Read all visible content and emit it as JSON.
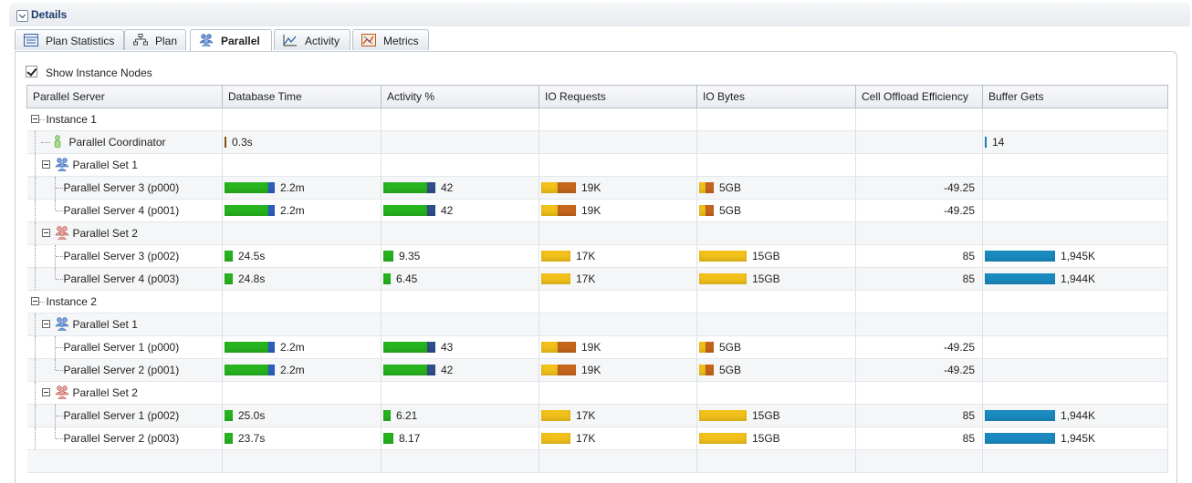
{
  "details": {
    "title": "Details"
  },
  "tabs": [
    {
      "label": "Plan Statistics",
      "icon": "table-icon",
      "active": false
    },
    {
      "label": "Plan",
      "icon": "tree-icon",
      "active": false
    },
    {
      "label": "Parallel",
      "icon": "people-icon",
      "active": true
    },
    {
      "label": "Activity",
      "icon": "line-chart-icon",
      "active": false
    },
    {
      "label": "Metrics",
      "icon": "metrics-icon",
      "active": false
    }
  ],
  "show_instance_nodes": {
    "label": "Show Instance Nodes",
    "checked": true
  },
  "columns": [
    "Parallel Server",
    "Database Time",
    "Activity %",
    "IO Requests",
    "IO Bytes",
    "Cell Offload Efficiency",
    "Buffer Gets"
  ],
  "colors": {
    "db_green": "#27b41e",
    "db_blue": "#2e5fc4",
    "act_navy": "#2f4f8a",
    "io_yellow": "#f2c21b",
    "io_orange": "#c8661b",
    "buf_cyan": "#1a8ac0"
  },
  "rows": [
    {
      "label": "Instance 1",
      "kind": "instance"
    },
    {
      "label": "Parallel Coordinator",
      "kind": "coordinator",
      "db_time": "0.3s",
      "buffer_gets": "14"
    },
    {
      "label": "Parallel Set 1",
      "kind": "set",
      "set_color": "blue"
    },
    {
      "label": "Parallel Server 3 (p000)",
      "kind": "server",
      "db_time": "2.2m",
      "activity": "42",
      "io_requests": "19K",
      "io_bytes": "5GB",
      "offload": "-49.25",
      "buffer_gets": ""
    },
    {
      "label": "Parallel Server 4 (p001)",
      "kind": "server",
      "db_time": "2.2m",
      "activity": "42",
      "io_requests": "19K",
      "io_bytes": "5GB",
      "offload": "-49.25",
      "buffer_gets": ""
    },
    {
      "label": "Parallel Set 2",
      "kind": "set",
      "set_color": "red"
    },
    {
      "label": "Parallel Server 3 (p002)",
      "kind": "server",
      "db_time": "24.5s",
      "activity": "9.35",
      "io_requests": "17K",
      "io_bytes": "15GB",
      "offload": "85",
      "buffer_gets": "1,945K"
    },
    {
      "label": "Parallel Server 4 (p003)",
      "kind": "server",
      "db_time": "24.8s",
      "activity": "6.45",
      "io_requests": "17K",
      "io_bytes": "15GB",
      "offload": "85",
      "buffer_gets": "1,944K"
    },
    {
      "label": "Instance 2",
      "kind": "instance"
    },
    {
      "label": "Parallel Set 1",
      "kind": "set",
      "set_color": "blue"
    },
    {
      "label": "Parallel Server 1 (p000)",
      "kind": "server",
      "db_time": "2.2m",
      "activity": "43",
      "io_requests": "19K",
      "io_bytes": "5GB",
      "offload": "-49.25",
      "buffer_gets": ""
    },
    {
      "label": "Parallel Server 2 (p001)",
      "kind": "server",
      "db_time": "2.2m",
      "activity": "42",
      "io_requests": "19K",
      "io_bytes": "5GB",
      "offload": "-49.25",
      "buffer_gets": ""
    },
    {
      "label": "Parallel Set 2",
      "kind": "set",
      "set_color": "red"
    },
    {
      "label": "Parallel Server 1 (p002)",
      "kind": "server",
      "db_time": "25.0s",
      "activity": "6.21",
      "io_requests": "17K",
      "io_bytes": "15GB",
      "offload": "85",
      "buffer_gets": "1,944K"
    },
    {
      "label": "Parallel Server 2 (p003)",
      "kind": "server",
      "db_time": "23.7s",
      "activity": "8.17",
      "io_requests": "17K",
      "io_bytes": "15GB",
      "offload": "85",
      "buffer_gets": "1,945K"
    }
  ]
}
